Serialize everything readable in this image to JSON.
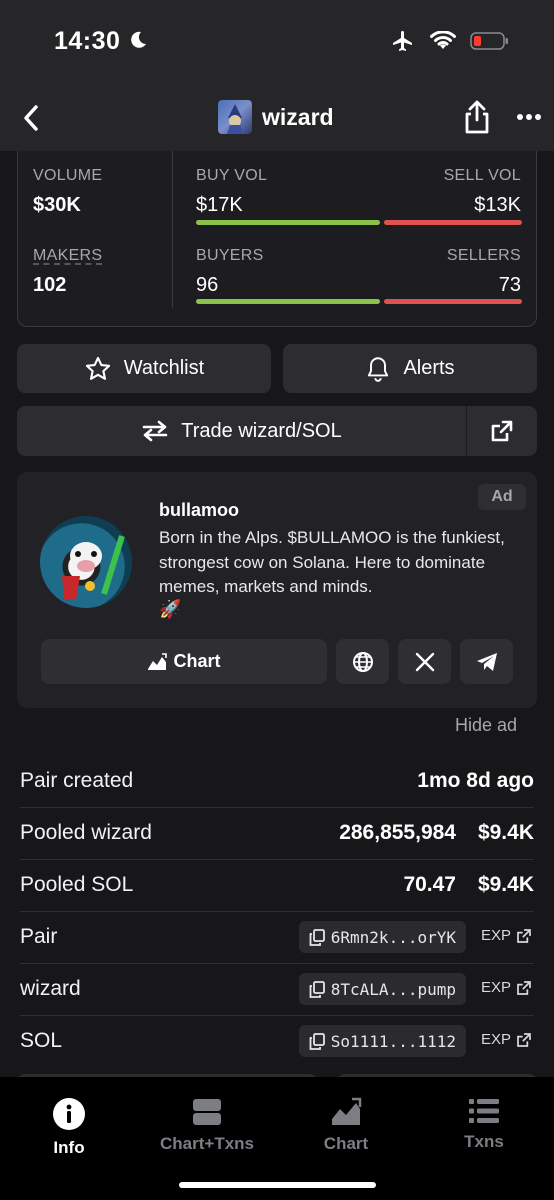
{
  "status_bar": {
    "time": "14:30"
  },
  "nav": {
    "title": "wizard"
  },
  "stats": {
    "volume_label": "VOLUME",
    "volume_value": "$30K",
    "buy_vol_label": "BUY VOL",
    "buy_vol_value": "$17K",
    "sell_vol_label": "SELL VOL",
    "sell_vol_value": "$13K",
    "makers_label": "MAKERS",
    "makers_value": "102",
    "buyers_label": "BUYERS",
    "buyers_value": "96",
    "sellers_label": "SELLERS",
    "sellers_value": "73",
    "buy_vol_share": 0.57,
    "buyers_share": 0.57
  },
  "actions": {
    "watchlist": "Watchlist",
    "alerts": "Alerts",
    "trade": "Trade wizard/SOL"
  },
  "ad": {
    "badge": "Ad",
    "name": "bullamoo",
    "description": "Born in the Alps. $BULLAMOO is the funkiest, strongest cow on Solana. Here to dominate memes, markets and minds.",
    "emoji": "🚀",
    "chart_button": "Chart",
    "hide": "Hide ad"
  },
  "info": {
    "pair_created_label": "Pair created",
    "pair_created_value": "1mo 8d ago",
    "pooled_token_label": "Pooled wizard",
    "pooled_token_amount": "286,855,984",
    "pooled_token_usd": "$9.4K",
    "pooled_sol_label": "Pooled SOL",
    "pooled_sol_amount": "70.47",
    "pooled_sol_usd": "$9.4K",
    "pair_label": "Pair",
    "pair_address": "6Rmn2k...orYK",
    "token_label": "wizard",
    "token_address": "8TcALA...pump",
    "sol_label": "SOL",
    "sol_address": "So1111...1112",
    "exp": "EXP"
  },
  "tabs": [
    "Info",
    "Chart+Txns",
    "Chart",
    "Txns"
  ],
  "colors": {
    "green": "#8bc34a",
    "red": "#e0524f",
    "background": "#17171a",
    "card": "#2c2c31"
  }
}
